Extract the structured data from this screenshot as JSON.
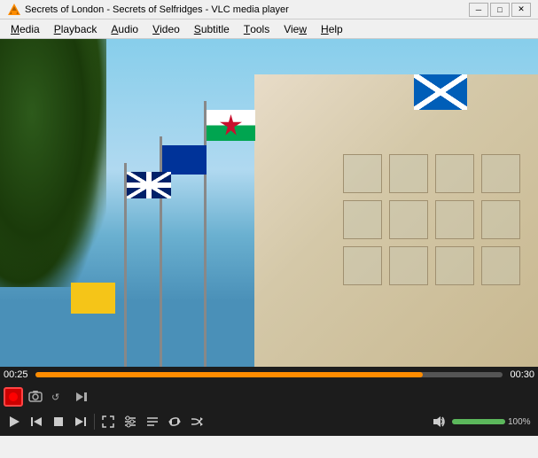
{
  "titleBar": {
    "title": "Secrets of London - Secrets of Selfridges - VLC media player",
    "minimizeLabel": "─",
    "maximizeLabel": "□",
    "closeLabel": "✕"
  },
  "menuBar": {
    "items": [
      {
        "id": "media",
        "label": "Media",
        "underlineIndex": 0
      },
      {
        "id": "playback",
        "label": "Playback",
        "underlineIndex": 0
      },
      {
        "id": "audio",
        "label": "Audio",
        "underlineIndex": 0
      },
      {
        "id": "video",
        "label": "Video",
        "underlineIndex": 0
      },
      {
        "id": "subtitle",
        "label": "Subtitle",
        "underlineIndex": 0
      },
      {
        "id": "tools",
        "label": "Tools",
        "underlineIndex": 0
      },
      {
        "id": "view",
        "label": "View",
        "underlineIndex": 0
      },
      {
        "id": "help",
        "label": "Help",
        "underlineIndex": 0
      }
    ]
  },
  "player": {
    "currentTime": "00:25",
    "totalTime": "00:30",
    "progressPercent": 83,
    "volume": 100,
    "volumeBarPercent": 100
  },
  "controls": {
    "row1": {
      "recordLabel": "⏺",
      "snapshotLabel": "📷",
      "loopLabel": "↺",
      "nextFrameLabel": "⏭"
    },
    "row2": {
      "playLabel": "▶",
      "prevLabel": "⏮",
      "stopLabel": "■",
      "nextLabel": "⏭",
      "fullscreenLabel": "⛶",
      "extAudioLabel": "♪",
      "playlistLabel": "☰",
      "loopLabel": "↻",
      "randomLabel": "⇄",
      "volumeIconLabel": "🔊",
      "volumePercent": "100%"
    }
  }
}
